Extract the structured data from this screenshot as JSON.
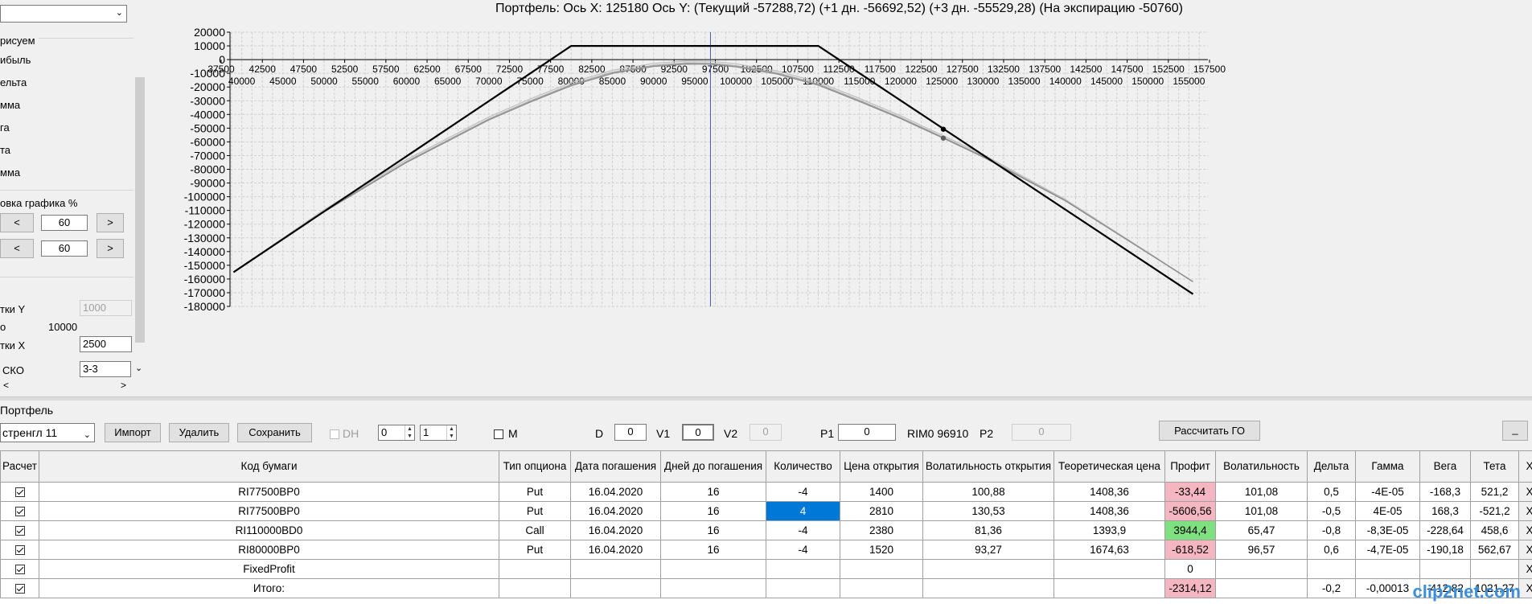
{
  "left_panel": {
    "top_combo_value": "",
    "draw_section_label": "рисуем",
    "series_items": [
      "ибыль",
      "ельта",
      "мма",
      "га",
      "та",
      "мма"
    ],
    "scale_label": "овка графика %",
    "scale_rows": [
      {
        "prev": "<",
        "value": "60",
        "next": ">"
      },
      {
        "prev": "<",
        "value": "60",
        "next": ">"
      }
    ],
    "grid_y_label": "тки Y",
    "grid_y_value": "1000",
    "o_label": "о",
    "o_value": "10000",
    "grid_x_label": "тки X",
    "grid_x_value": "2500",
    "sko_label": "СКО",
    "sko_value": "3-3",
    "hscroll_left": "<",
    "hscroll_right": ">"
  },
  "chart_data": {
    "type": "line",
    "title": "Портфель: Ось X: 125180 Ось Y:  (Текущий -57288,72)  (+1 дн. -56692,52)  (+3 дн. -55529,28)  (На экспирацию -50760)",
    "xlim": [
      37500,
      157500
    ],
    "ylim": [
      -180000,
      20000
    ],
    "y_ticks": [
      20000,
      10000,
      0,
      -10000,
      -20000,
      -30000,
      -40000,
      -50000,
      -60000,
      -70000,
      -80000,
      -90000,
      -100000,
      -110000,
      -120000,
      -130000,
      -140000,
      -150000,
      -160000,
      -170000,
      -180000
    ],
    "x_ticks_upper": [
      37500,
      42500,
      47500,
      52500,
      57500,
      62500,
      67500,
      72500,
      77500,
      82500,
      87500,
      92500,
      97500,
      102500,
      107500,
      112500,
      117500,
      122500,
      127500,
      132500,
      137500,
      142500,
      147500,
      152500,
      157500
    ],
    "x_ticks_lower": [
      40000,
      45000,
      50000,
      55000,
      60000,
      65000,
      70000,
      75000,
      80000,
      85000,
      90000,
      95000,
      100000,
      105000,
      110000,
      115000,
      120000,
      125000,
      130000,
      135000,
      140000,
      145000,
      150000,
      155000
    ],
    "grid": true,
    "cursor_x": 96910,
    "marker_x": 125180,
    "series": [
      {
        "id": "expiration",
        "color": "#000000",
        "width": 2.2,
        "x": [
          39000,
          80000,
          110000,
          155500
        ],
        "values": [
          -155000,
          9960,
          9960,
          -171000
        ]
      },
      {
        "id": "current",
        "color": "#8a8a8a",
        "width": 1.3,
        "x": [
          39000,
          50000,
          60000,
          70000,
          75000,
          80000,
          85000,
          90000,
          94000,
          96910,
          100000,
          105000,
          110000,
          115000,
          120000,
          125180,
          130000,
          140000,
          150000,
          155500
        ],
        "values": [
          -155000,
          -111000,
          -75000,
          -44000,
          -31000,
          -19000,
          -10000,
          -5000,
          -3200,
          -3400,
          -5300,
          -10500,
          -18600,
          -30500,
          -43000,
          -57289,
          -71000,
          -103000,
          -141000,
          -162000
        ]
      },
      {
        "id": "plus1",
        "color": "#a8a8a8",
        "width": 1.3,
        "x": [
          39000,
          50000,
          60000,
          70000,
          75000,
          80000,
          85000,
          90000,
          94000,
          96910,
          100000,
          105000,
          110000,
          115000,
          120000,
          125180,
          130000,
          140000,
          150000,
          155500
        ],
        "values": [
          -155000,
          -110500,
          -74300,
          -43200,
          -30200,
          -18200,
          -9200,
          -4200,
          -2400,
          -2600,
          -4500,
          -9700,
          -17800,
          -29700,
          -42300,
          -56693,
          -70400,
          -102700,
          -140800,
          -162000
        ]
      },
      {
        "id": "plus3",
        "color": "#c0c0c0",
        "width": 1.3,
        "x": [
          39000,
          50000,
          60000,
          70000,
          75000,
          80000,
          85000,
          90000,
          94000,
          96910,
          100000,
          105000,
          110000,
          115000,
          120000,
          125180,
          130000,
          140000,
          150000,
          155500
        ],
        "values": [
          -155000,
          -109500,
          -73000,
          -41800,
          -28800,
          -16800,
          -7800,
          -2800,
          -1000,
          -1200,
          -3100,
          -8300,
          -16400,
          -28300,
          -41000,
          -55529,
          -69200,
          -102000,
          -140500,
          -162000
        ]
      }
    ],
    "markers": [
      {
        "x": 125180,
        "y": -50760,
        "color": "#000000"
      },
      {
        "x": 125180,
        "y": -57289,
        "color": "#606060"
      }
    ]
  },
  "toolbar": {
    "portfolio_label": "Портфель",
    "portfolio_combo": "стренгл 11",
    "import_label": "Импорт",
    "delete_label": "Удалить",
    "save_label": "Сохранить",
    "dh_label": "DH",
    "spin1_value": "0",
    "spin2_value": "1",
    "m_label": "M",
    "d_label": "D",
    "d_value": "0",
    "v1_label": "V1",
    "v1_value": "0",
    "v2_label": "V2",
    "v2_value": "0",
    "p1_label": "P1",
    "p1_value": "0",
    "rim_label": "RIM0 96910",
    "p2_label": "P2",
    "p2_value": "0",
    "calc_go_label": "Рассчитать ГО",
    "minimize_label": "_"
  },
  "table": {
    "headers": [
      "Расчет",
      "Код бумаги",
      "Тип опциона",
      "Дата погашения",
      "Дней до погашения",
      "Количество",
      "Цена открытия",
      "Волатильность открытия",
      "Теоретическая цена",
      "Профит",
      "Волатильность",
      "Дельта",
      "Гамма",
      "Вега",
      "Тета",
      "X"
    ],
    "rows": [
      {
        "code": "RI77500BP0",
        "type": "Put",
        "date": "16.04.2020",
        "days": "16",
        "qty": "-4",
        "price": "1400",
        "vol_open": "100,88",
        "theo": "1408,36",
        "profit": "-33,44",
        "vol": "101,08",
        "delta": "0,5",
        "gamma": "-4E-05",
        "vega": "-168,3",
        "theta": "521,2",
        "x": "X"
      },
      {
        "code": "RI77500BP0",
        "type": "Put",
        "date": "16.04.2020",
        "days": "16",
        "qty": "4",
        "price": "2810",
        "vol_open": "130,53",
        "theo": "1408,36",
        "profit": "-5606,56",
        "vol": "101,08",
        "delta": "-0,5",
        "gamma": "4E-05",
        "vega": "168,3",
        "theta": "-521,2",
        "x": "X"
      },
      {
        "code": "RI110000BD0",
        "type": "Call",
        "date": "16.04.2020",
        "days": "16",
        "qty": "-4",
        "price": "2380",
        "vol_open": "81,36",
        "theo": "1393,9",
        "profit": "3944,4",
        "vol": "65,47",
        "delta": "-0,8",
        "gamma": "-8,3E-05",
        "vega": "-228,64",
        "theta": "458,6",
        "x": "X"
      },
      {
        "code": "RI80000BP0",
        "type": "Put",
        "date": "16.04.2020",
        "days": "16",
        "qty": "-4",
        "price": "1520",
        "vol_open": "93,27",
        "theo": "1674,63",
        "profit": "-618,52",
        "vol": "96,57",
        "delta": "0,6",
        "gamma": "-4,7E-05",
        "vega": "-190,18",
        "theta": "562,67",
        "x": "X"
      },
      {
        "code": "FixedProfit",
        "type": "",
        "date": "",
        "days": "",
        "qty": "",
        "price": "",
        "vol_open": "",
        "theo": "",
        "profit": "0",
        "vol": "",
        "delta": "",
        "gamma": "",
        "vega": "",
        "theta": "",
        "x": "X"
      },
      {
        "code": "Итого:",
        "type": "",
        "date": "",
        "days": "",
        "qty": "",
        "price": "",
        "vol_open": "",
        "theo": "",
        "profit": "-2314,12",
        "vol": "",
        "delta": "-0,2",
        "gamma": "-0,00013",
        "vega": "-412,82",
        "theta": "1021,27",
        "x": "X"
      }
    ]
  },
  "watermark": "clip2net.com"
}
